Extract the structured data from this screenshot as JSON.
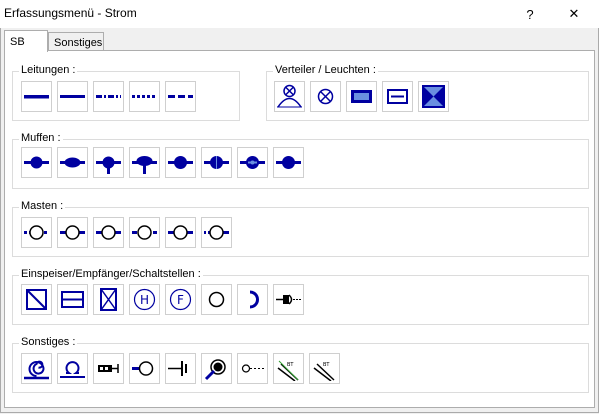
{
  "window": {
    "title": "Erfassungsmenü - Strom",
    "help_label": "?",
    "close_label": "✕"
  },
  "tabs": [
    {
      "label": "SB"
    },
    {
      "label": "Sonstiges"
    }
  ],
  "groups": {
    "leitungen": {
      "label": "Leitungen :"
    },
    "verteiler": {
      "label": "Verteiler / Leuchten :"
    },
    "muffen": {
      "label": "Muffen :"
    },
    "masten": {
      "label": "Masten :"
    },
    "einspeiser": {
      "label": "Einspeiser/Empfänger/Schaltstellen :"
    },
    "sonstiges": {
      "label": "Sonstiges :"
    }
  },
  "icon_text": {
    "h": "H",
    "f": "F",
    "bt": "BT"
  },
  "colors": {
    "accent": "#0000a0",
    "border": "#cfcfcf",
    "light_blue": "#6a8fe0"
  }
}
